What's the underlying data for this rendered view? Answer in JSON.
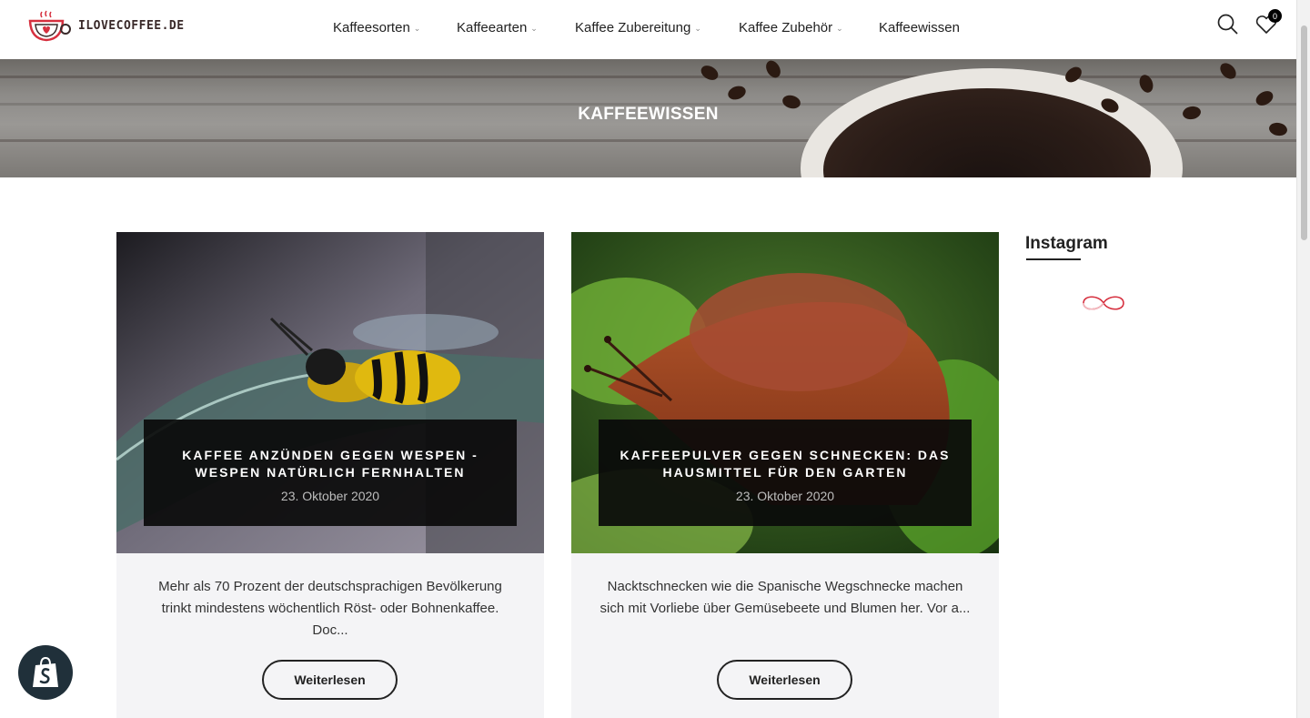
{
  "header": {
    "logo_text": "ILOVECOFFEE.DE",
    "nav": [
      {
        "label": "Kaffeesorten",
        "has_dropdown": true
      },
      {
        "label": "Kaffeearten",
        "has_dropdown": true
      },
      {
        "label": "Kaffee Zubereitung",
        "has_dropdown": true
      },
      {
        "label": "Kaffee Zubehör",
        "has_dropdown": true
      },
      {
        "label": "Kaffeewissen",
        "has_dropdown": false
      }
    ],
    "wishlist_count": "0",
    "icons": [
      "search-icon",
      "heart-icon"
    ]
  },
  "hero": {
    "title": "KAFFEEWISSEN"
  },
  "posts": [
    {
      "title": "KAFFEE ANZÜNDEN GEGEN WESPEN - WESPEN NATÜRLICH FERNHALTEN",
      "date": "23. Oktober 2020",
      "excerpt": "Mehr als 70 Prozent der deutschsprachigen Bevölkerung trinkt mindestens wöchentlich Röst- oder Bohnenkaffee. Doc...",
      "button": "Weiterlesen",
      "image": "wasp-photo"
    },
    {
      "title": "KAFFEEPULVER GEGEN SCHNECKEN: DAS HAUSMITTEL FÜR DEN GARTEN",
      "date": "23. Oktober 2020",
      "excerpt": "Nacktschnecken wie die Spanische Wegschnecke machen sich mit Vorliebe über Gemüsebeete und Blumen her. Vor a...",
      "button": "Weiterlesen",
      "image": "slug-photo"
    }
  ],
  "sidebar": {
    "title": "Instagram"
  },
  "colors": {
    "accent": "#d6303f",
    "overlay": "#0a0a0a",
    "card_bg": "#f4f4f6",
    "shop_badge": "#20303a"
  }
}
